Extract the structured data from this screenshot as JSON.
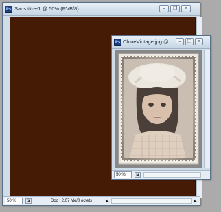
{
  "window_main": {
    "title": "Sans titre-1 @ 50% (RVB/8)",
    "app_icon": "Ps",
    "minimize_glyph": "–",
    "restore_glyph": "❐",
    "close_glyph": "✕",
    "zoom": "50 %",
    "doc_info": "Doc : 2,07 Mo/0 octets",
    "canvas_color": "#461b05"
  },
  "window_photo": {
    "title": "ChloeVintage.jpg @ ...",
    "app_icon": "Ps",
    "minimize_glyph": "–",
    "restore_glyph": "❐",
    "close_glyph": "✕",
    "zoom": "50 %"
  },
  "colors": {
    "titlebar_top": "#e9f0f7",
    "titlebar_bottom": "#c6d6e5",
    "window_frame": "#cfdde9",
    "workspace": "#ababab"
  }
}
